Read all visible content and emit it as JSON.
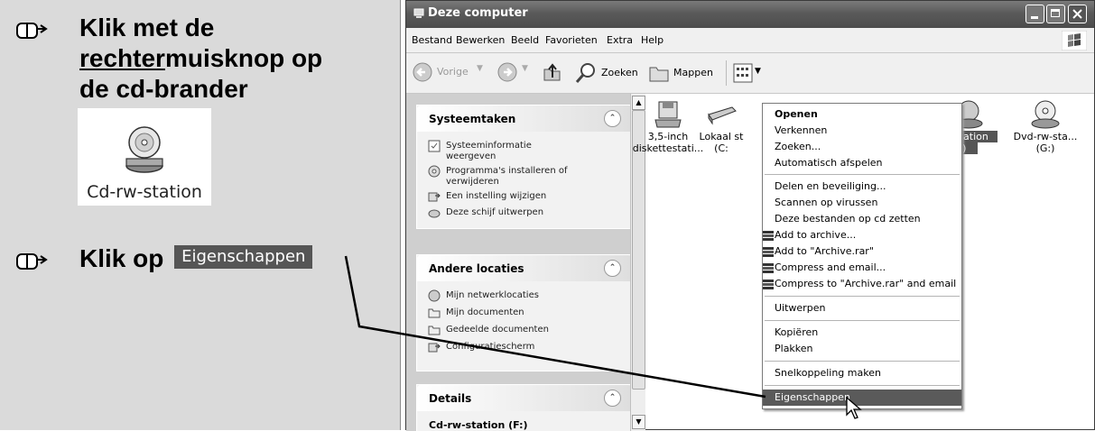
{
  "instructions": {
    "step1": {
      "line1": "Klik met de",
      "line2_underlined": "rechter",
      "line2_rest": "muisknop op",
      "line3": "de cd-brander"
    },
    "drive_thumbnail_label": "Cd-rw-station",
    "step2": {
      "prefix": "Klik op",
      "button_label": "Eigenschappen"
    }
  },
  "window": {
    "title": "Deze computer",
    "menu": [
      "Bestand",
      "Bewerken",
      "Beeld",
      "Favorieten",
      "Extra",
      "Help"
    ],
    "toolbar": {
      "back": "Vorige",
      "search": "Zoeken",
      "folders": "Mappen"
    }
  },
  "taskpane": {
    "system_tasks": {
      "title": "Systeemtaken",
      "items": [
        "Systeeminformatie weergeven",
        "Programma's installeren of verwijderen",
        "Een instelling wijzigen",
        "Deze schijf uitwerpen"
      ]
    },
    "other_places": {
      "title": "Andere locaties",
      "items": [
        "Mijn netwerklocaties",
        "Mijn documenten",
        "Gedeelde documenten",
        "Configuratiescherm"
      ]
    },
    "details": {
      "title": "Details",
      "selected": "Cd-rw-station (F:)"
    }
  },
  "drives": [
    {
      "line1": "3,5-inch",
      "line2": "diskettestati..."
    },
    {
      "line1": "Lokaal st",
      "line2": "(C:"
    },
    {
      "line1": "station",
      "line2": "F:)"
    },
    {
      "line1": "Dvd-rw-sta...",
      "line2": "(G:)"
    }
  ],
  "context_menu": {
    "items": [
      "Openen",
      "Verkennen",
      "Zoeken...",
      "Automatisch afspelen",
      "Delen en beveiliging...",
      "Scannen op virussen",
      "Deze bestanden op cd zetten",
      "Add to archive...",
      "Add to \"Archive.rar\"",
      "Compress and email...",
      "Compress to \"Archive.rar\" and email",
      "Uitwerpen",
      "Kopiëren",
      "Plakken",
      "Snelkoppeling maken",
      "Eigenschappen"
    ],
    "selected": "Eigenschappen"
  },
  "icons": [
    "mouse-pointer-hand-icon",
    "cd-drive-icon",
    "floppy-drive-icon",
    "hard-drive-icon",
    "dvd-drive-icon",
    "winrar-icon",
    "arrow-cursor-icon"
  ]
}
